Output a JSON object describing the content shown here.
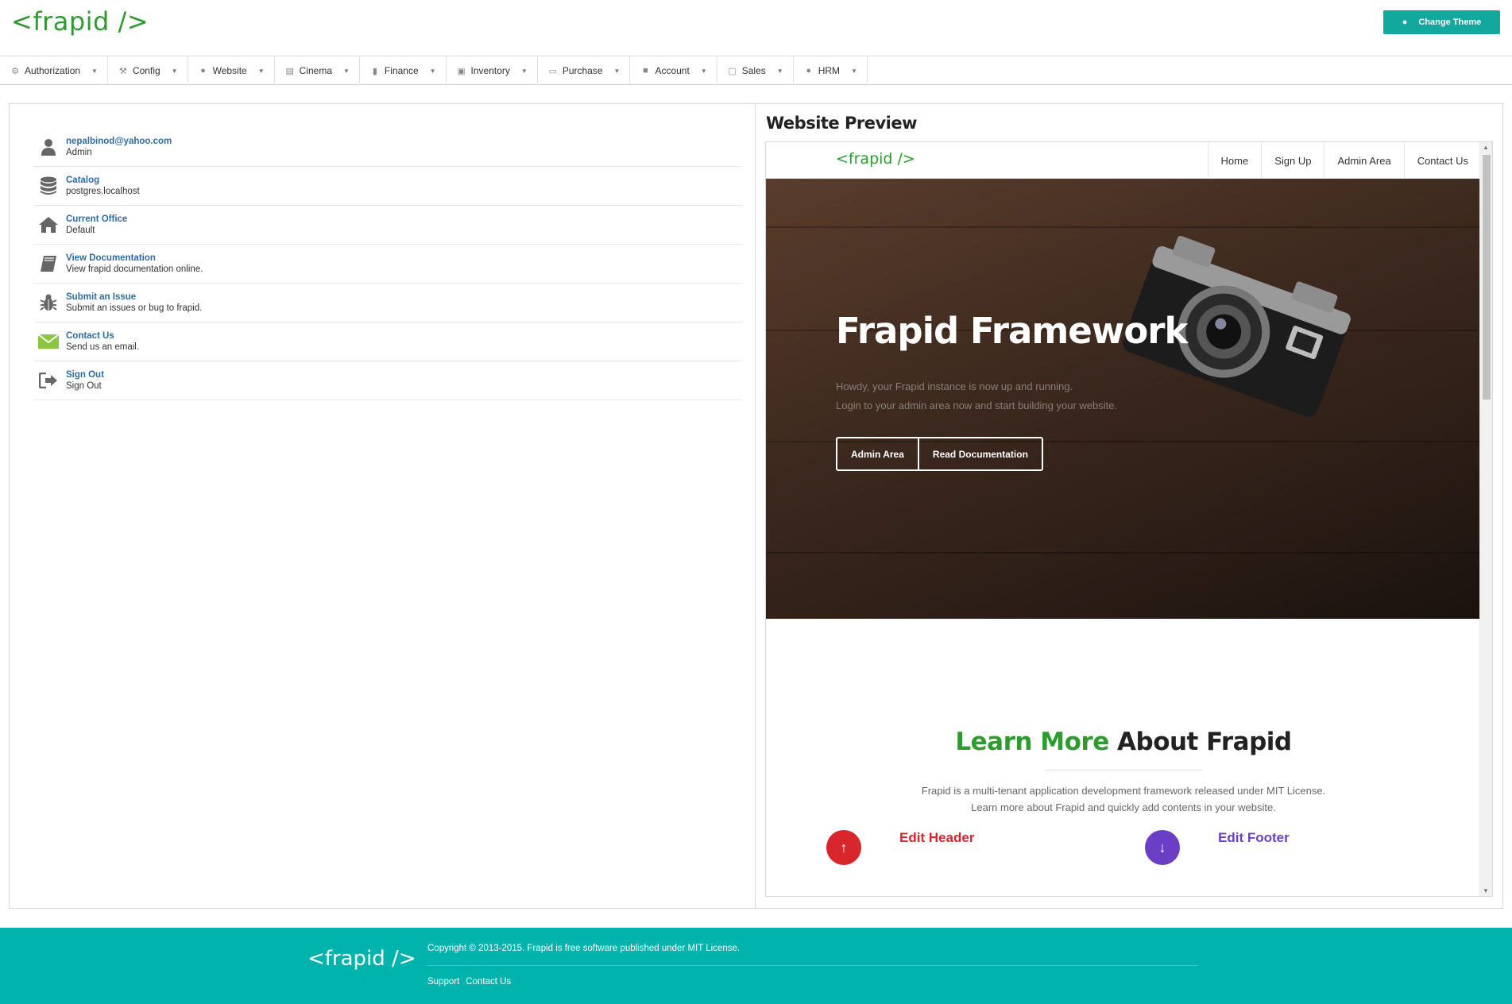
{
  "app": {
    "logo": "<frapid />",
    "change_theme": "Change Theme"
  },
  "nav": [
    {
      "label": "Authorization",
      "icon": "key-icon"
    },
    {
      "label": "Config",
      "icon": "wrench-icon"
    },
    {
      "label": "Website",
      "icon": "globe-icon"
    },
    {
      "label": "Cinema",
      "icon": "film-icon"
    },
    {
      "label": "Finance",
      "icon": "book-icon"
    },
    {
      "label": "Inventory",
      "icon": "cart-icon"
    },
    {
      "label": "Purchase",
      "icon": "credit-card-icon"
    },
    {
      "label": "Account",
      "icon": "lock-icon"
    },
    {
      "label": "Sales",
      "icon": "truck-icon"
    },
    {
      "label": "HRM",
      "icon": "user-icon"
    }
  ],
  "info": [
    {
      "title": "nepalbinod@yahoo.com",
      "sub": "Admin",
      "icon": "user-icon"
    },
    {
      "title": "Catalog",
      "sub": "postgres.localhost",
      "icon": "database-icon"
    },
    {
      "title": "Current Office",
      "sub": "Default",
      "icon": "home-icon"
    },
    {
      "title": "View Documentation",
      "sub": "View frapid documentation online.",
      "icon": "book-icon"
    },
    {
      "title": "Submit an Issue",
      "sub": "Submit an issues or bug to frapid.",
      "icon": "bug-icon"
    },
    {
      "title": "Contact Us",
      "sub": "Send us an email.",
      "icon": "mail-icon"
    },
    {
      "title": "Sign Out",
      "sub": "Sign Out",
      "icon": "sign-out-icon"
    }
  ],
  "preview": {
    "title": "Website Preview",
    "site_logo": "<frapid />",
    "menu": [
      "Home",
      "Sign Up",
      "Admin Area",
      "Contact Us"
    ],
    "hero_title": "Frapid Framework",
    "hero_line1": "Howdy, your Frapid instance is now up and running.",
    "hero_line2": "Login to your admin area now and start building your website.",
    "btn_admin": "Admin Area",
    "btn_docs": "Read Documentation",
    "learn_green": "Learn More",
    "learn_rest": " About Frapid",
    "learn_line1": "Frapid is a multi-tenant application development framework released under MIT License.",
    "learn_line2": "Learn more about Frapid and quickly add contents in your website.",
    "feature1": "Edit Header",
    "feature2": "Edit Footer"
  },
  "footer": {
    "logo": "<frapid />",
    "copyright": "Copyright © 2013-2015. Frapid is free software published under MIT License.",
    "link1": "Support",
    "link2": "Contact Us"
  },
  "colors": {
    "brand_green": "#2e9b2e",
    "teal": "#13a89e",
    "footer": "#00b3ad",
    "link_blue": "#2f6ba5",
    "red": "#d9262c",
    "purple": "#6a3fc6"
  }
}
